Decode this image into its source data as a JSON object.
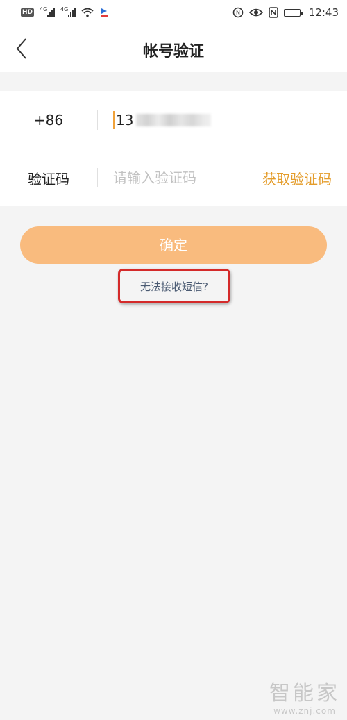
{
  "status_bar": {
    "hd_label": "HD",
    "net1_label": "4G",
    "net2_label": "4G",
    "time": "12:43"
  },
  "header": {
    "title": "帐号验证"
  },
  "form": {
    "phone": {
      "country_code": "+86",
      "value_visible": "13"
    },
    "code": {
      "label": "验证码",
      "placeholder": "请输入验证码",
      "get_code_label": "获取验证码"
    }
  },
  "confirm_label": "确定",
  "no_sms_link": "无法接收短信?",
  "watermark": {
    "main": "智能家",
    "url": "www.znj.com"
  },
  "colors": {
    "accent": "#e49c2a",
    "button_bg": "#f9bb7e",
    "highlight": "#d42a2a",
    "page_bg": "#f4f4f4"
  }
}
